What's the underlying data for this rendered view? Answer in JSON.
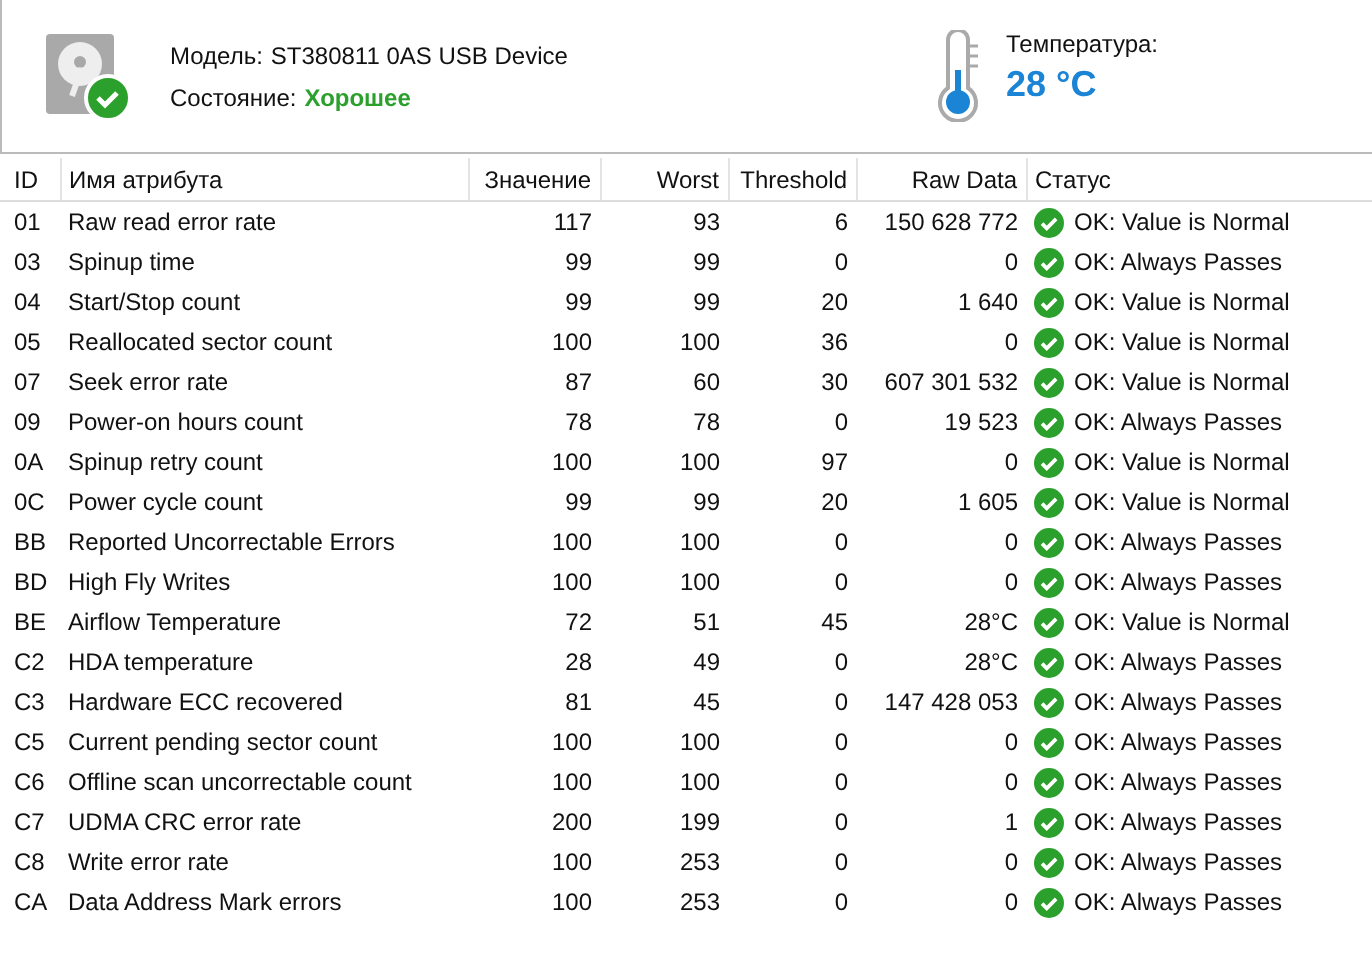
{
  "header": {
    "model_label": "Модель:",
    "model": "ST380811 0AS USB Device",
    "state_label": "Состояние:",
    "state": "Хорошее",
    "temperature_label": "Температура:",
    "temperature": "28 °C"
  },
  "table": {
    "columns": [
      "ID",
      "Имя атрибута",
      "Значение",
      "Worst",
      "Threshold",
      "Raw Data",
      "Статус"
    ],
    "rows": [
      {
        "id": "01",
        "name": "Raw read error rate",
        "value": "117",
        "worst": "93",
        "threshold": "6",
        "raw": "150 628 772",
        "status": "OK: Value is Normal",
        "kind": "ok"
      },
      {
        "id": "03",
        "name": "Spinup time",
        "value": "99",
        "worst": "99",
        "threshold": "0",
        "raw": "0",
        "status": "OK: Always Passes",
        "kind": "ok"
      },
      {
        "id": "04",
        "name": "Start/Stop count",
        "value": "99",
        "worst": "99",
        "threshold": "20",
        "raw": "1 640",
        "status": "OK: Value is Normal",
        "kind": "ok"
      },
      {
        "id": "05",
        "name": "Reallocated sector count",
        "value": "100",
        "worst": "100",
        "threshold": "36",
        "raw": "0",
        "status": "OK: Value is Normal",
        "kind": "ok"
      },
      {
        "id": "07",
        "name": "Seek error rate",
        "value": "87",
        "worst": "60",
        "threshold": "30",
        "raw": "607 301 532",
        "status": "OK: Value is Normal",
        "kind": "ok"
      },
      {
        "id": "09",
        "name": "Power-on hours count",
        "value": "78",
        "worst": "78",
        "threshold": "0",
        "raw": "19 523",
        "status": "OK: Always Passes",
        "kind": "ok"
      },
      {
        "id": "0A",
        "name": "Spinup retry count",
        "value": "100",
        "worst": "100",
        "threshold": "97",
        "raw": "0",
        "status": "OK: Value is Normal",
        "kind": "ok"
      },
      {
        "id": "0C",
        "name": "Power cycle count",
        "value": "99",
        "worst": "99",
        "threshold": "20",
        "raw": "1 605",
        "status": "OK: Value is Normal",
        "kind": "ok"
      },
      {
        "id": "BB",
        "name": "Reported Uncorrectable Errors",
        "value": "100",
        "worst": "100",
        "threshold": "0",
        "raw": "0",
        "status": "OK: Always Passes",
        "kind": "ok"
      },
      {
        "id": "BD",
        "name": "High Fly Writes",
        "value": "100",
        "worst": "100",
        "threshold": "0",
        "raw": "0",
        "status": "OK: Always Passes",
        "kind": "ok"
      },
      {
        "id": "BE",
        "name": "Airflow Temperature",
        "value": "72",
        "worst": "51",
        "threshold": "45",
        "raw": "28°C",
        "status": "OK: Value is Normal",
        "kind": "ok"
      },
      {
        "id": "C2",
        "name": "HDA temperature",
        "value": "28",
        "worst": "49",
        "threshold": "0",
        "raw": "28°C",
        "status": "OK: Always Passes",
        "kind": "ok"
      },
      {
        "id": "C3",
        "name": "Hardware ECC recovered",
        "value": "81",
        "worst": "45",
        "threshold": "0",
        "raw": "147 428 053",
        "status": "OK: Always Passes",
        "kind": "ok"
      },
      {
        "id": "C5",
        "name": "Current pending sector count",
        "value": "100",
        "worst": "100",
        "threshold": "0",
        "raw": "0",
        "status": "OK: Always Passes",
        "kind": "ok"
      },
      {
        "id": "C6",
        "name": "Offline scan uncorrectable count",
        "value": "100",
        "worst": "100",
        "threshold": "0",
        "raw": "0",
        "status": "OK: Always Passes",
        "kind": "ok"
      },
      {
        "id": "C7",
        "name": "UDMA CRC error rate",
        "value": "200",
        "worst": "199",
        "threshold": "0",
        "raw": "1",
        "status": "OK: Always Passes",
        "kind": "ok"
      },
      {
        "id": "C8",
        "name": "Write error rate",
        "value": "100",
        "worst": "253",
        "threshold": "0",
        "raw": "0",
        "status": "OK: Always Passes",
        "kind": "ok"
      },
      {
        "id": "CA",
        "name": "Data Address Mark errors",
        "value": "100",
        "worst": "253",
        "threshold": "0",
        "raw": "0",
        "status": "OK: Always Passes",
        "kind": "ok"
      }
    ]
  }
}
